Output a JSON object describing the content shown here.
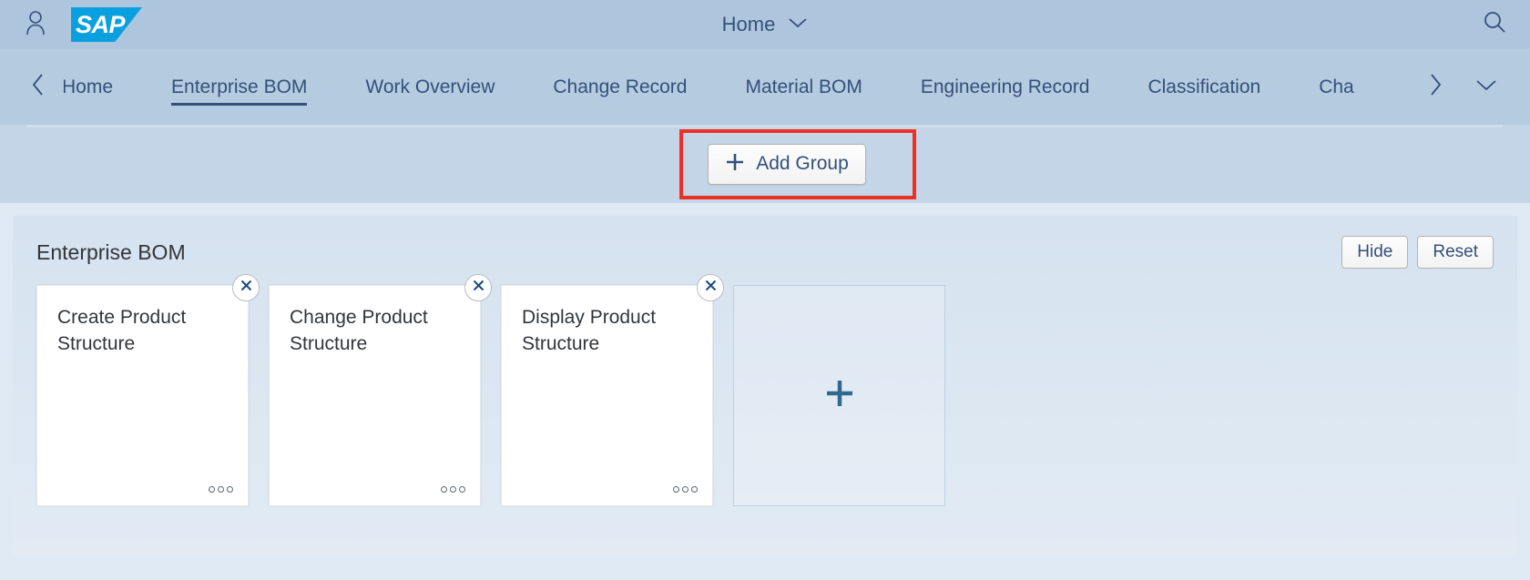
{
  "shell": {
    "user_icon": "user-icon",
    "logo_text": "SAP",
    "title": "Home",
    "title_chevron_icon": "chevron-down-icon",
    "search_icon": "search-icon"
  },
  "navbar": {
    "prev_icon": "chevron-left-icon",
    "next_icon": "chevron-right-icon",
    "overflow_icon": "chevron-down-icon",
    "tabs": [
      {
        "label": "Home",
        "active": false,
        "clipped_left": true
      },
      {
        "label": "Enterprise BOM",
        "active": true,
        "clipped_left": false
      },
      {
        "label": "Work Overview",
        "active": false,
        "clipped_left": false
      },
      {
        "label": "Change Record",
        "active": false,
        "clipped_left": false
      },
      {
        "label": "Material BOM",
        "active": false,
        "clipped_left": false
      },
      {
        "label": "Engineering Record",
        "active": false,
        "clipped_left": false
      },
      {
        "label": "Classification",
        "active": false,
        "clipped_left": false
      },
      {
        "label": "Cha",
        "active": false,
        "clipped_left": false
      }
    ]
  },
  "toolbar": {
    "add_group_label": "Add Group",
    "add_group_icon": "plus-icon",
    "highlight_color": "#ee3124"
  },
  "group": {
    "title": "Enterprise BOM",
    "hide_label": "Hide",
    "reset_label": "Reset",
    "tiles": [
      {
        "title": "Create Product Structure",
        "close_icon": "close-icon",
        "more_icon": "more-dots-icon"
      },
      {
        "title": "Change Product Structure",
        "close_icon": "close-icon",
        "more_icon": "more-dots-icon"
      },
      {
        "title": "Display Product Structure",
        "close_icon": "close-icon",
        "more_icon": "more-dots-icon"
      }
    ],
    "placeholder_icon": "plus-icon"
  },
  "colors": {
    "sap_blue": "#0aa0e0",
    "text_blue": "#33507a",
    "shell_bg": "#aec6dd",
    "tabbar_bg": "#b5cbe0",
    "strip_bg": "#c3d5e6"
  }
}
